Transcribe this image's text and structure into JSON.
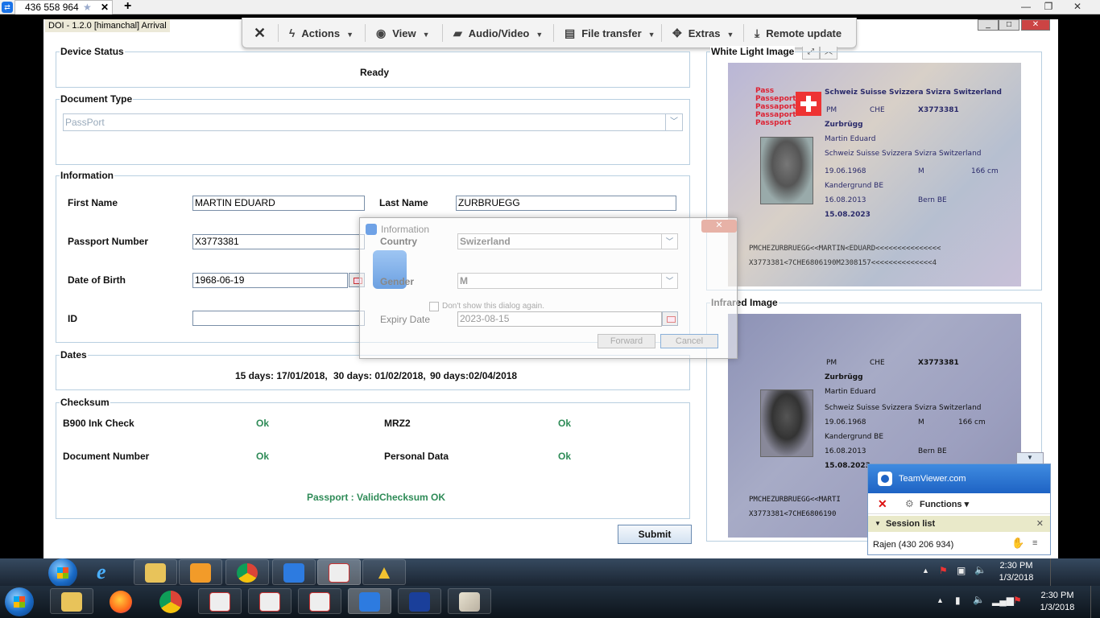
{
  "teamviewer": {
    "tab_label": "436 558 964",
    "toolbar": {
      "close_icon": "close-icon",
      "actions": "Actions",
      "view": "View",
      "audio_video": "Audio/Video",
      "file_transfer": "File transfer",
      "extras": "Extras",
      "remote_update": "Remote update"
    }
  },
  "app": {
    "title": "DOI - 1.2.0  [himanchal] Arrival",
    "device_status": {
      "group": "Device Status",
      "value": "Ready"
    },
    "document_type": {
      "group": "Document Type",
      "selected": "PassPort"
    },
    "information": {
      "group": "Information",
      "first_name_label": "First Name",
      "first_name": "MARTIN EDUARD",
      "last_name_label": "Last Name",
      "last_name": "ZURBRUEGG",
      "passport_label": "Passport Number",
      "passport": "X3773381",
      "dob_label": "Date of Birth",
      "dob": "1968-06-19",
      "id_label": "ID",
      "id": "",
      "country_label": "Country",
      "country": "Swizerland",
      "gender_label": "Gender",
      "gender": "M",
      "expiry_label": "Expiry Date",
      "expiry": "2023-08-15"
    },
    "dates": {
      "group": "Dates",
      "d15": "15 days: 17/01/2018,",
      "d30": "30 days: 01/02/2018,",
      "d90": "90 days:02/04/2018"
    },
    "checksum": {
      "group": "Checksum",
      "b900_label": "B900 Ink Check",
      "b900": "Ok",
      "mrz2_label": "MRZ2",
      "mrz2": "Ok",
      "docnum_label": "Document Number",
      "docnum": "Ok",
      "personal_label": "Personal Data",
      "personal": "Ok",
      "summary_passport": "Passport : Valid",
      "summary_checksum": "Checksum OK"
    },
    "submit": "Submit",
    "white_light_title": "White Light Image",
    "infrared_title": "Infrared Image"
  },
  "passport_image": {
    "pass_labels": [
      "Pass",
      "Passeport",
      "Passaporto",
      "Passaport",
      "Passport"
    ],
    "country_line": "Schweiz Suisse Svizzera Svizra Switzerland",
    "pm": "PM",
    "che": "CHE",
    "number": "X3773381",
    "surname": "Zurbrügg",
    "given": "Martin Eduard",
    "nationality": "Schweiz Suisse Svizzera Svizra Switzerland",
    "dob": "19.06.1968",
    "sex": "M",
    "height": "166 cm",
    "place": "Kandergrund BE",
    "issue": "16.08.2013",
    "authority": "Bern BE",
    "expiry": "15.08.2023",
    "mrz1": "PMCHEZURBRUEGG<<MARTIN<EDUARD<<<<<<<<<<<<<<<",
    "mrz2": "X3773381<7CHE6806190M2308157<<<<<<<<<<<<<<4",
    "ir_mrz1": "PMCHEZURBRUEGG<<MARTI",
    "ir_mrz2": "X3773381<7CHE6806190"
  },
  "dialog": {
    "title": "Information",
    "checkbox": "Don't show this dialog again.",
    "forward": "Forward",
    "cancel": "Cancel"
  },
  "tv_panel": {
    "brand": "TeamViewer.com",
    "functions": "Functions",
    "session_list": "Session list",
    "session": "Rajen (430 206 934)"
  },
  "taskbar_remote": {
    "time": "2:30 PM",
    "date": "1/3/2018"
  },
  "taskbar_local": {
    "time": "2:30 PM",
    "date": "1/3/2018"
  },
  "colors": {
    "ok_green": "#2e8b57",
    "tv_blue": "#1e63c4",
    "group_border": "#b8cfe0"
  }
}
